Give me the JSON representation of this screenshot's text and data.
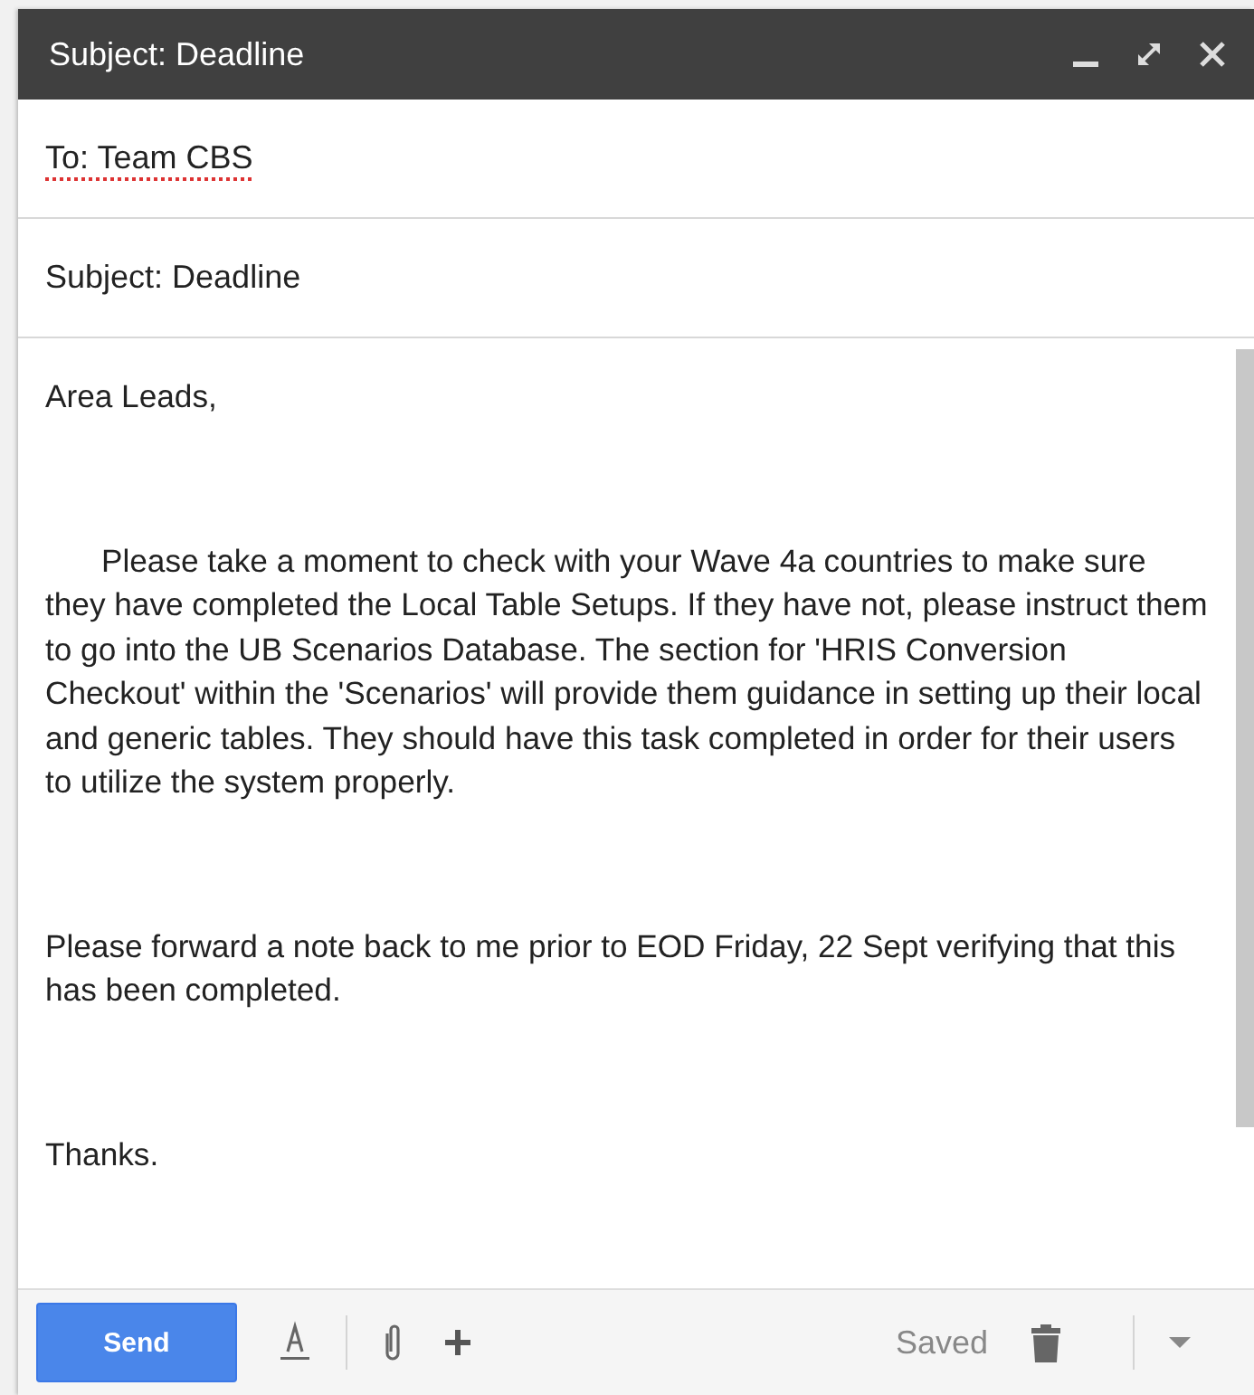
{
  "window": {
    "title": "Subject: Deadline"
  },
  "to": {
    "value": "To: Team CBS",
    "flagged": true
  },
  "subject": {
    "value": "Subject: Deadline"
  },
  "body": [
    {
      "kind": "greeting",
      "text": "Area Leads,"
    },
    {
      "kind": "indented",
      "text": "Please take a moment to check with your Wave 4a countries to make sure they have completed the Local Table Setups.  If they have not, please instruct them to go into the UB Scenarios Database.  The section for 'HRIS Conversion Checkout' within the 'Scenarios' will provide them guidance in setting up their local and generic tables.  They should have this task completed in order for their users to utilize the system properly."
    },
    {
      "kind": "plain",
      "text": "Please forward a note back to me prior to EOD Friday, 22 Sept verifying that this has been completed."
    },
    {
      "kind": "plain",
      "text": "Thanks."
    }
  ],
  "footer": {
    "send": "Send",
    "status": "Saved"
  }
}
